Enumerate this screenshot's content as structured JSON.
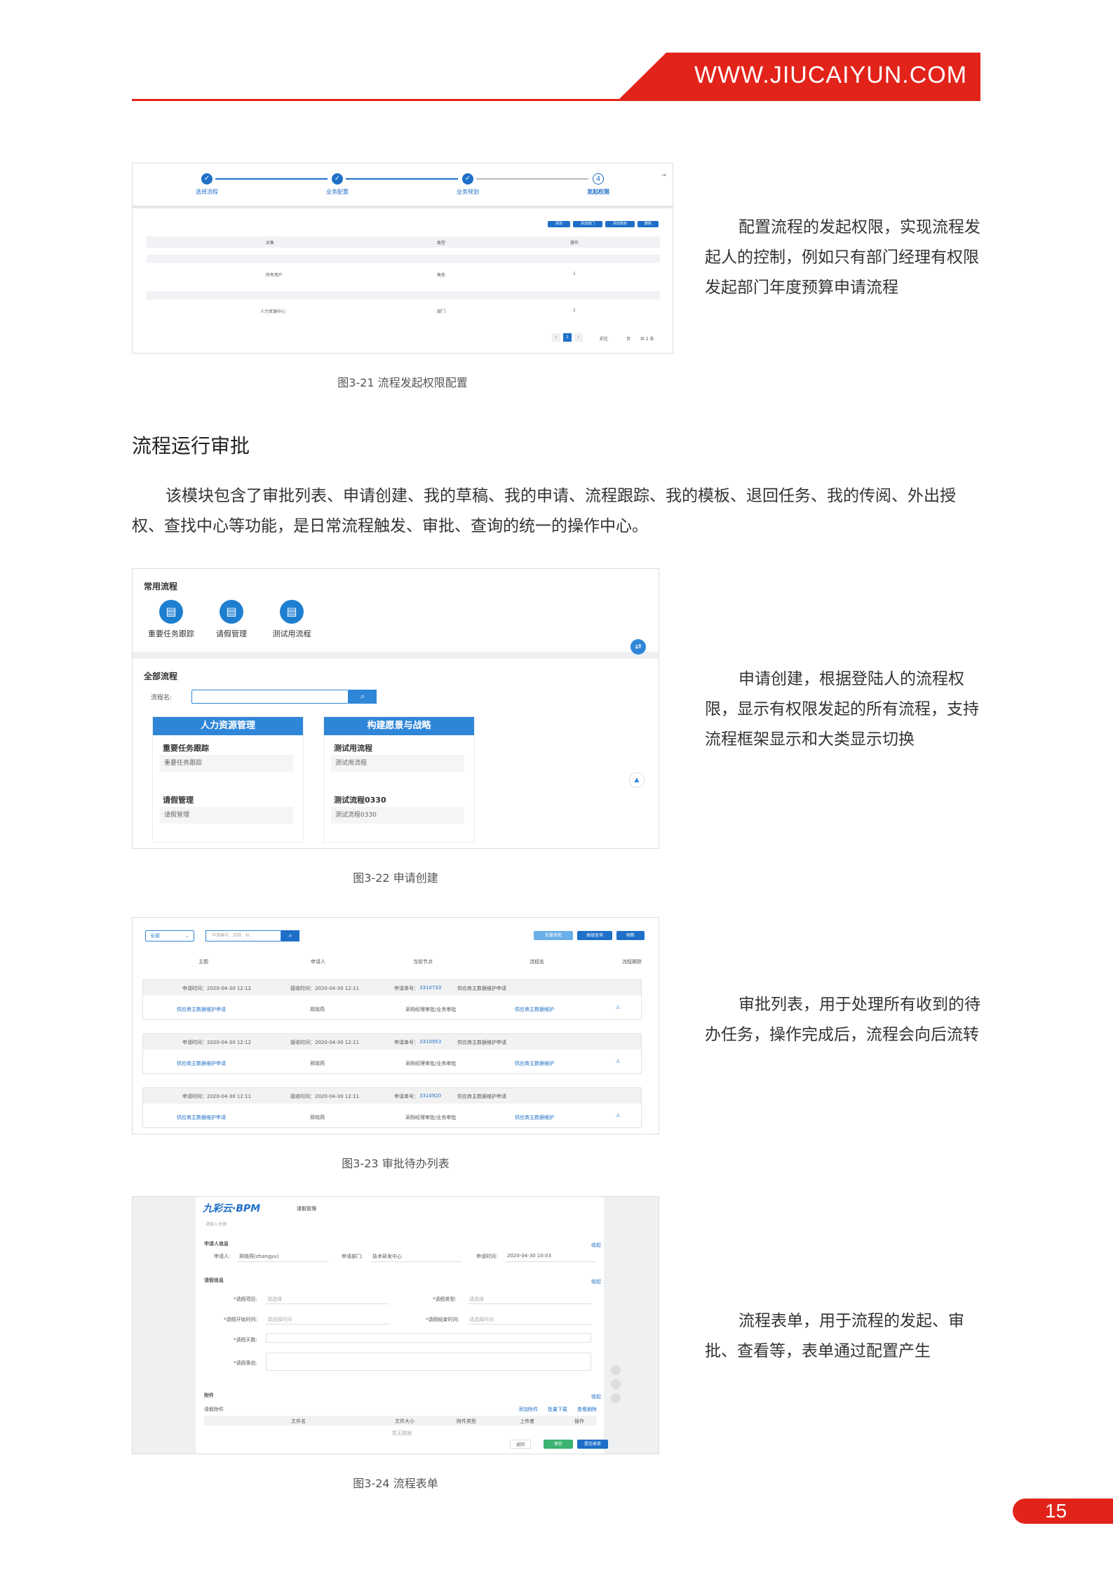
{
  "header": {
    "url": "WWW.JIUCAIYUN.COM"
  },
  "page_number": "15",
  "fig21": {
    "caption": "图3-21 流程发起权限配置",
    "steps": [
      "选择流程",
      "业务配置",
      "业务规划",
      "发起权限"
    ],
    "step4_num": "4",
    "buttons": [
      "添加",
      "添加部门",
      "添加角色",
      "删除"
    ],
    "cols": [
      "对象",
      "类型",
      "操作"
    ],
    "rows": [
      [
        "所有用户",
        "角色",
        "1"
      ],
      [
        "人力资源中心",
        "部门",
        "1"
      ]
    ],
    "pager": {
      "page": "1",
      "goto": "前往",
      "unit": "页",
      "total": "共 2 条"
    },
    "description": "配置流程的发起权限，实现流程发起人的控制，例如只有部门经理有权限发起部门年度预算申请流程"
  },
  "section": {
    "title": "流程运行审批",
    "intro": "该模块包含了审批列表、申请创建、我的草稿、我的申请、流程跟踪、我的模板、退回任务、我的传阅、外出授权、查找中心等功能，是日常流程触发、审批、查询的统一的操作中心。"
  },
  "fig22": {
    "caption": "图3-22 申请创建",
    "common_title": "常用流程",
    "favorites": [
      "重要任务跟踪",
      "请假管理",
      "测试用流程"
    ],
    "all_title": "全部流程",
    "search_label": "流程名:",
    "panels": [
      {
        "title": "人力资源管理",
        "groups": [
          {
            "title": "重要任务跟踪",
            "item": "重要任务跟踪"
          },
          {
            "title": "请假管理",
            "item": "请假管理"
          }
        ]
      },
      {
        "title": "构建愿景与战略",
        "groups": [
          {
            "title": "测试用流程",
            "item": "测试用流程"
          },
          {
            "title": "测试流程0330",
            "item": "测试流程0330"
          }
        ]
      }
    ],
    "description": "申请创建，根据登陆人的流程权限，显示有权限发起的所有流程，支持流程框架显示和大类显示切换"
  },
  "fig23": {
    "caption": "图3-23 审批待办列表",
    "filter": "全部",
    "search_placeholder": "申请编号、流程、标",
    "buttons": [
      "批量审批",
      "高级查询",
      "刷新"
    ],
    "cols": [
      "主题",
      "申请人",
      "当前节点",
      "流程名",
      "流程跟踪"
    ],
    "rows": [
      {
        "meta": [
          "申请时间：2020-04-30 12:12",
          "接收时间：2020-04-30 12:11",
          "申请单号：",
          "3310733",
          "供应商主数据维护申请"
        ],
        "main": [
          "供应商主数据维护申请",
          "邢晓燕",
          "采购经理审批/业务审批",
          "供应商主数据维护"
        ]
      },
      {
        "meta": [
          "申请时间：2020-04-30 12:12",
          "接收时间：2020-04-30 12:11",
          "申请单号：",
          "3310953",
          "供应商主数据维护申请"
        ],
        "main": [
          "供应商主数据维护申请",
          "邢晓燕",
          "采购经理审批/业务审批",
          "供应商主数据维护"
        ]
      },
      {
        "meta": [
          "申请时间：2020-04-30 12:11",
          "接收时间：2020-04-30 12:11",
          "申请单号：",
          "3310920",
          "供应商主数据维护申请"
        ],
        "main": [
          "供应商主数据维护申请",
          "邢晓燕",
          "采购经理审批/业务审批",
          "供应商主数据维护"
        ]
      }
    ],
    "description": "审批列表，用于处理所有收到的待办任务，操作完成后，流程会向后流转"
  },
  "fig24": {
    "caption": "图3-24 流程表单",
    "logo": "九彩云·BPM",
    "form_title": "请假管理",
    "search_placeholder": "请输入关键",
    "sec_applicant": "申请人信息",
    "applicant_label": "申请人:",
    "applicant_value": "邢晓燕(zhangyu)",
    "dept_label": "申请部门:",
    "dept_value": "技术研发中心",
    "time_label": "申请时间:",
    "time_value": "2020-04-30 10:03",
    "sec_leave": "请假信息",
    "collapse": "收起",
    "fields": [
      "*请假项目:",
      "*请假类型:",
      "*请假开始时间:",
      "*请假结束时间:",
      "*请假天数:",
      "*请假事由:"
    ],
    "placeholder_select": "请选择",
    "placeholder_date": "请选择时间",
    "sec_attach": "附件",
    "attach_label": "请假附件",
    "attach_actions": [
      "添加附件",
      "批量下载",
      "查看删除"
    ],
    "attach_cols": [
      "文件名",
      "文件大小",
      "附件类型",
      "上传者",
      "操作"
    ],
    "attach_empty": "暂无数据",
    "buttons": [
      "返回",
      "保存",
      "提交表单"
    ],
    "description": "流程表单，用于流程的发起、审批、查看等，表单通过配置产生"
  }
}
